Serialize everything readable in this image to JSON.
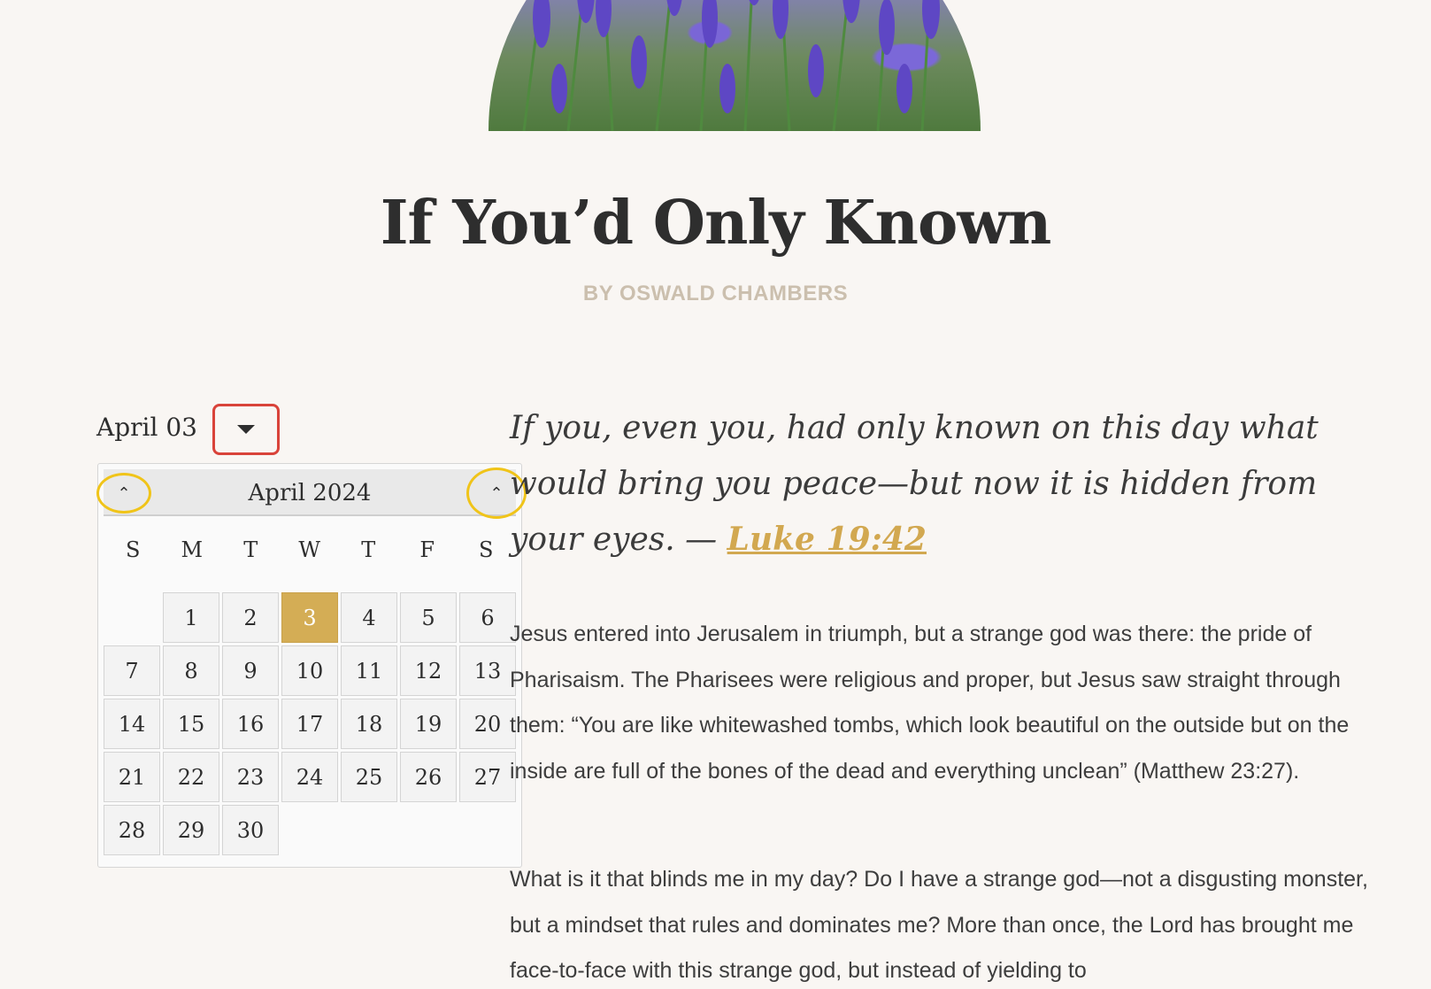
{
  "hero": {
    "image_name": "lavender-field"
  },
  "title": "If You’d Only Known",
  "byline": "BY OSWALD CHAMBERS",
  "date_picker": {
    "current_label": "April 03",
    "toggle_icon": "caret-down-icon"
  },
  "calendar": {
    "month_title": "April 2024",
    "prev_icon": "chevron-up-icon",
    "next_icon": "chevron-up-icon",
    "weekdays": [
      "S",
      "M",
      "T",
      "W",
      "T",
      "F",
      "S"
    ],
    "leading_blanks": 1,
    "days": [
      "1",
      "2",
      "3",
      "4",
      "5",
      "6",
      "7",
      "8",
      "9",
      "10",
      "11",
      "12",
      "13",
      "14",
      "15",
      "16",
      "17",
      "18",
      "19",
      "20",
      "21",
      "22",
      "23",
      "24",
      "25",
      "26",
      "27",
      "28",
      "29",
      "30"
    ],
    "selected_day": "3",
    "accent_color": "#d4ad55"
  },
  "quote": {
    "text": "If you, even you, had only known on this day what would bring you peace—but now it is hidden from your eyes. —",
    "reference": "Luke 19:42"
  },
  "paragraphs": [
    "Jesus entered into Jerusalem in triumph, but a strange god was there: the pride of Pharisaism. The Pharisees were religious and proper, but Jesus saw straight through them: “You are like whitewashed tombs, which look beautiful on the outside but on the inside are full of the bones of the dead and everything unclean” (Matthew 23:27).",
    "What is it that blinds me in my day? Do I have a strange god—not a disgusting monster, but a mindset that rules and dominates me? More than once, the Lord has brought me face-to-face with this strange god, but instead of yielding to"
  ]
}
